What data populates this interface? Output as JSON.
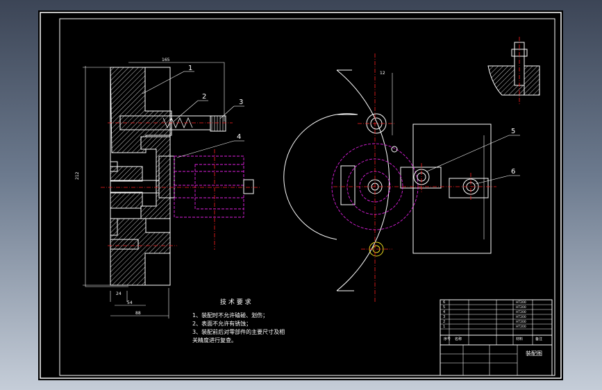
{
  "callouts": [
    "1",
    "2",
    "3",
    "4",
    "5",
    "6"
  ],
  "dims": {
    "top": "165",
    "left_vertical": "212",
    "bottom_small": "24",
    "bottom_mid": "54",
    "bottom_wide": "88",
    "right_top": "12"
  },
  "tech": {
    "title": "技 术 要 求",
    "items": [
      "1、装配时不允许磕碰、划伤；",
      "2、表面不允许有锈蚀；",
      "3、装配前后对零部件的主要尺寸及相",
      "关精度进行复查。"
    ]
  },
  "title_block": {
    "drawing_name": "装配图",
    "header_seq": "序号",
    "header_name": "名称",
    "header_material": "材料",
    "header_note": "备注",
    "parts": [
      {
        "no": "6",
        "material": "HT200"
      },
      {
        "no": "5",
        "material": "HT200"
      },
      {
        "no": "4",
        "material": "HT200"
      },
      {
        "no": "3",
        "material": "HT200"
      },
      {
        "no": "2",
        "material": "HT200"
      },
      {
        "no": "1",
        "material": "HT200"
      }
    ]
  },
  "colors": {
    "outline": "#ffffff",
    "center_line": "#ff2020",
    "hidden_line": "#e020e0",
    "hole": "#f0e020",
    "background": "#000000"
  }
}
